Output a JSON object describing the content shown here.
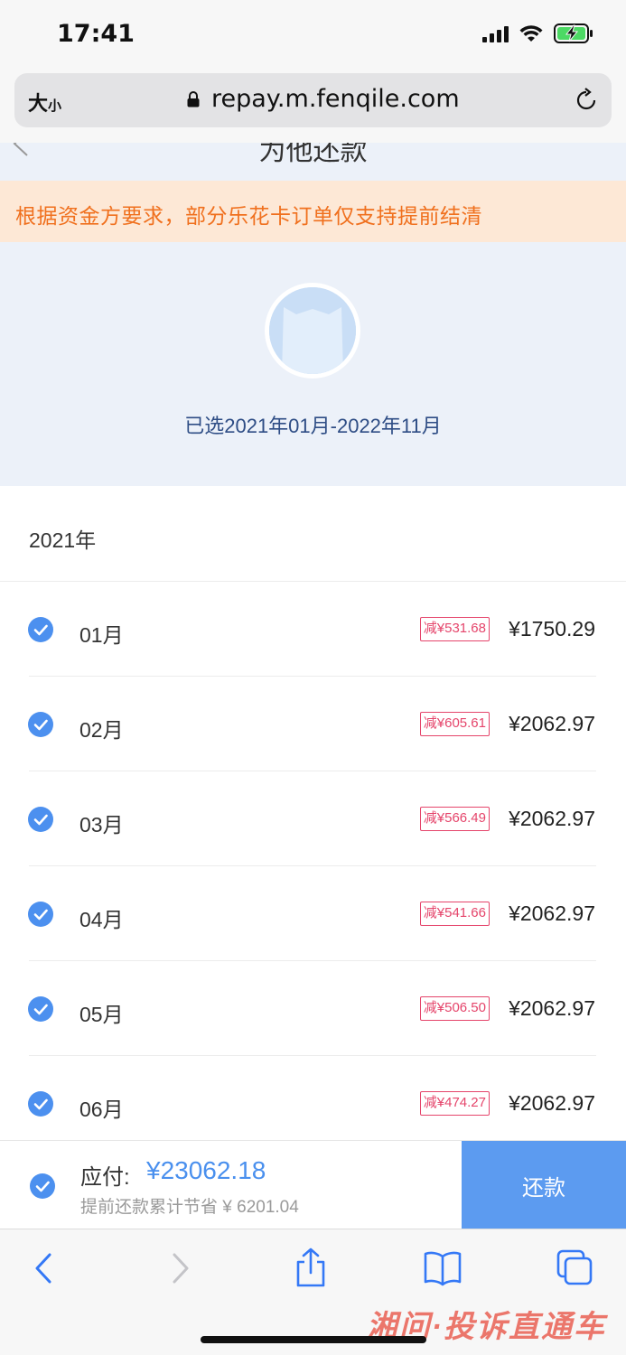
{
  "status_bar": {
    "time": "17:41"
  },
  "browser": {
    "text_size_label_big": "大",
    "text_size_label_small": "小",
    "url": "repay.m.fenqile.com"
  },
  "page": {
    "title": "为他还款",
    "notice": "根据资金方要求，部分乐花卡订单仅支持提前结清",
    "selected_range": "已选2021年01月-2022年11月",
    "year": "2021年"
  },
  "months": [
    {
      "label": "01月",
      "discount": "减¥531.68",
      "amount": "¥1750.29",
      "checked": true
    },
    {
      "label": "02月",
      "discount": "减¥605.61",
      "amount": "¥2062.97",
      "checked": true
    },
    {
      "label": "03月",
      "discount": "减¥566.49",
      "amount": "¥2062.97",
      "checked": true
    },
    {
      "label": "04月",
      "discount": "减¥541.66",
      "amount": "¥2062.97",
      "checked": true
    },
    {
      "label": "05月",
      "discount": "减¥506.50",
      "amount": "¥2062.97",
      "checked": true
    },
    {
      "label": "06月",
      "discount": "减¥474.27",
      "amount": "¥2062.97",
      "checked": true
    }
  ],
  "pay_bar": {
    "label": "应付:",
    "amount": "¥23062.18",
    "savings": "提前还款累计节省 ¥ 6201.04",
    "button": "还款"
  },
  "watermark": "湘问·投诉直通车",
  "colors": {
    "accent_blue": "#4c90ef",
    "notice_bg": "#fde8d6",
    "notice_text": "#f0701e",
    "discount_red": "#e5456b",
    "hero_bg": "#ecf1f9"
  }
}
